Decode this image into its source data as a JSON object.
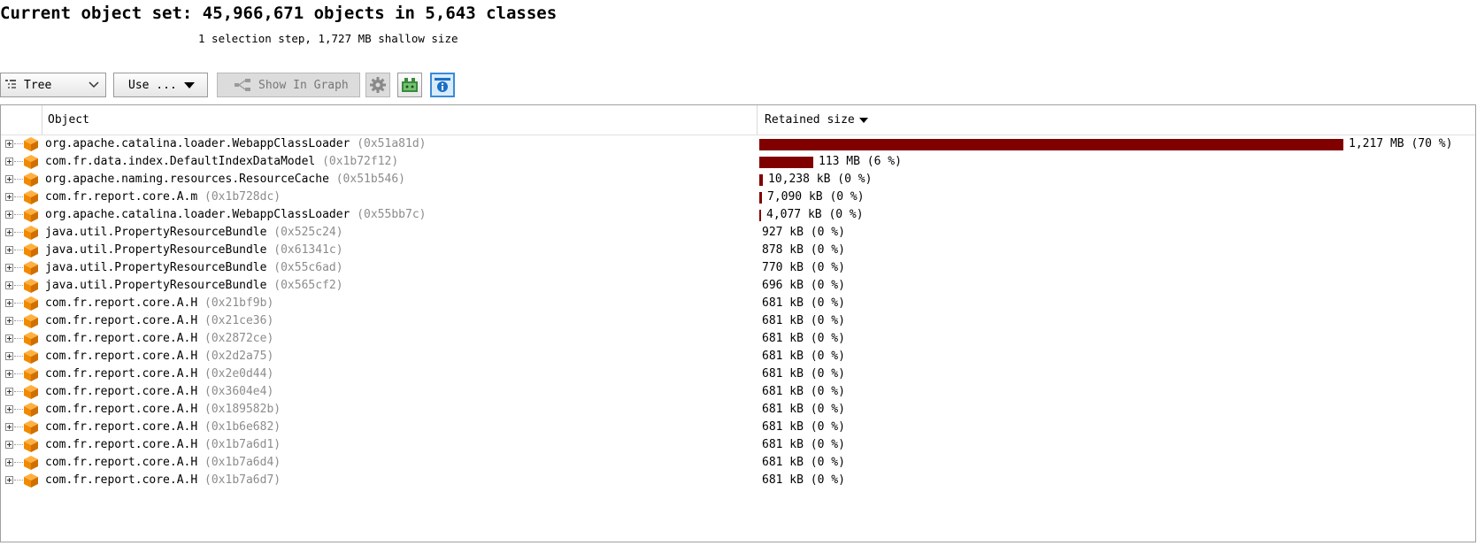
{
  "header": {
    "title": "Current object set: 45,966,671 objects in 5,643 classes",
    "subtitle": "1 selection step, 1,727 MB shallow size"
  },
  "toolbar": {
    "view_label": "Tree",
    "use_label": "Use ...",
    "graph_label": "Show In Graph",
    "icons": [
      "tree-view-icon",
      "gear-icon",
      "screenshot-icon",
      "info-icon"
    ]
  },
  "table": {
    "columns": {
      "object": "Object",
      "retained": "Retained size"
    },
    "sort": "retained-desc",
    "rows": [
      {
        "name": "org.apache.catalina.loader.WebappClassLoader",
        "addr": "(0x51a81d)",
        "retained": "1,217 MB (70 %)",
        "fraction": 0.7
      },
      {
        "name": "com.fr.data.index.DefaultIndexDataModel",
        "addr": "(0x1b72f12)",
        "retained": "113 MB (6 %)",
        "fraction": 0.065
      },
      {
        "name": "org.apache.naming.resources.ResourceCache",
        "addr": "(0x51b546)",
        "retained": "10,238 kB (0 %)",
        "fraction": 0.0058
      },
      {
        "name": "com.fr.report.core.A.m",
        "addr": "(0x1b728dc)",
        "retained": "7,090 kB (0 %)",
        "fraction": 0.004
      },
      {
        "name": "org.apache.catalina.loader.WebappClassLoader",
        "addr": "(0x55bb7c)",
        "retained": "4,077 kB (0 %)",
        "fraction": 0.0023
      },
      {
        "name": "java.util.PropertyResourceBundle",
        "addr": "(0x525c24)",
        "retained": "927 kB (0 %)",
        "fraction": 0
      },
      {
        "name": "java.util.PropertyResourceBundle",
        "addr": "(0x61341c)",
        "retained": "878 kB (0 %)",
        "fraction": 0
      },
      {
        "name": "java.util.PropertyResourceBundle",
        "addr": "(0x55c6ad)",
        "retained": "770 kB (0 %)",
        "fraction": 0
      },
      {
        "name": "java.util.PropertyResourceBundle",
        "addr": "(0x565cf2)",
        "retained": "696 kB (0 %)",
        "fraction": 0
      },
      {
        "name": "com.fr.report.core.A.H",
        "addr": "(0x21bf9b)",
        "retained": "681 kB (0 %)",
        "fraction": 0
      },
      {
        "name": "com.fr.report.core.A.H",
        "addr": "(0x21ce36)",
        "retained": "681 kB (0 %)",
        "fraction": 0
      },
      {
        "name": "com.fr.report.core.A.H",
        "addr": "(0x2872ce)",
        "retained": "681 kB (0 %)",
        "fraction": 0
      },
      {
        "name": "com.fr.report.core.A.H",
        "addr": "(0x2d2a75)",
        "retained": "681 kB (0 %)",
        "fraction": 0
      },
      {
        "name": "com.fr.report.core.A.H",
        "addr": "(0x2e0d44)",
        "retained": "681 kB (0 %)",
        "fraction": 0
      },
      {
        "name": "com.fr.report.core.A.H",
        "addr": "(0x3604e4)",
        "retained": "681 kB (0 %)",
        "fraction": 0
      },
      {
        "name": "com.fr.report.core.A.H",
        "addr": "(0x189582b)",
        "retained": "681 kB (0 %)",
        "fraction": 0
      },
      {
        "name": "com.fr.report.core.A.H",
        "addr": "(0x1b6e682)",
        "retained": "681 kB (0 %)",
        "fraction": 0
      },
      {
        "name": "com.fr.report.core.A.H",
        "addr": "(0x1b7a6d1)",
        "retained": "681 kB (0 %)",
        "fraction": 0
      },
      {
        "name": "com.fr.report.core.A.H",
        "addr": "(0x1b7a6d4)",
        "retained": "681 kB (0 %)",
        "fraction": 0
      },
      {
        "name": "com.fr.report.core.A.H",
        "addr": "(0x1b7a6d7)",
        "retained": "681 kB (0 %)",
        "fraction": 0
      }
    ]
  },
  "colors": {
    "bar": "#800000",
    "cube": "#f08a00",
    "address": "#8c8c8c"
  }
}
